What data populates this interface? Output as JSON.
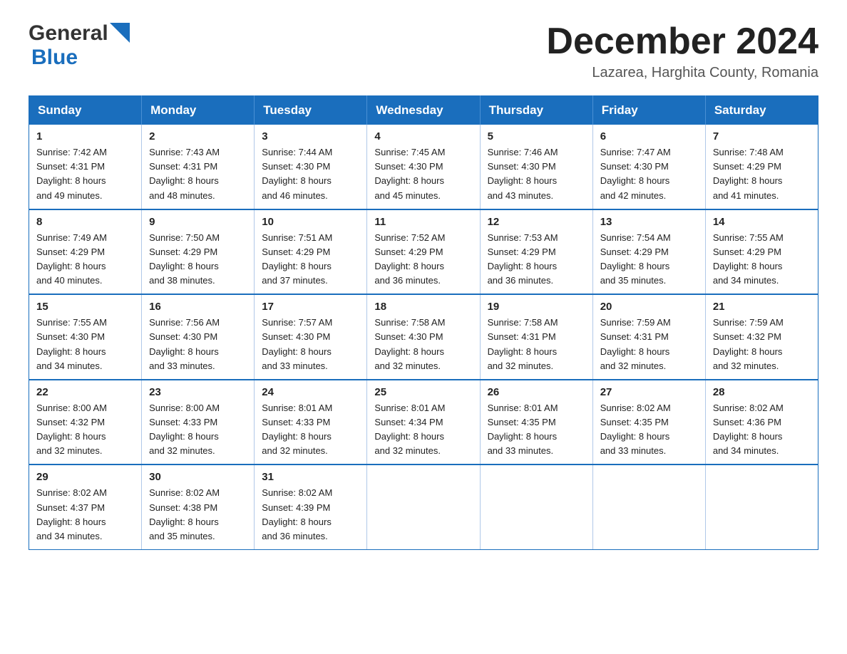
{
  "header": {
    "logo_general": "General",
    "logo_blue": "Blue",
    "month_title": "December 2024",
    "location": "Lazarea, Harghita County, Romania"
  },
  "calendar": {
    "days_of_week": [
      "Sunday",
      "Monday",
      "Tuesday",
      "Wednesday",
      "Thursday",
      "Friday",
      "Saturday"
    ],
    "weeks": [
      [
        {
          "day": "1",
          "sunrise": "7:42 AM",
          "sunset": "4:31 PM",
          "daylight": "8 hours and 49 minutes."
        },
        {
          "day": "2",
          "sunrise": "7:43 AM",
          "sunset": "4:31 PM",
          "daylight": "8 hours and 48 minutes."
        },
        {
          "day": "3",
          "sunrise": "7:44 AM",
          "sunset": "4:30 PM",
          "daylight": "8 hours and 46 minutes."
        },
        {
          "day": "4",
          "sunrise": "7:45 AM",
          "sunset": "4:30 PM",
          "daylight": "8 hours and 45 minutes."
        },
        {
          "day": "5",
          "sunrise": "7:46 AM",
          "sunset": "4:30 PM",
          "daylight": "8 hours and 43 minutes."
        },
        {
          "day": "6",
          "sunrise": "7:47 AM",
          "sunset": "4:30 PM",
          "daylight": "8 hours and 42 minutes."
        },
        {
          "day": "7",
          "sunrise": "7:48 AM",
          "sunset": "4:29 PM",
          "daylight": "8 hours and 41 minutes."
        }
      ],
      [
        {
          "day": "8",
          "sunrise": "7:49 AM",
          "sunset": "4:29 PM",
          "daylight": "8 hours and 40 minutes."
        },
        {
          "day": "9",
          "sunrise": "7:50 AM",
          "sunset": "4:29 PM",
          "daylight": "8 hours and 38 minutes."
        },
        {
          "day": "10",
          "sunrise": "7:51 AM",
          "sunset": "4:29 PM",
          "daylight": "8 hours and 37 minutes."
        },
        {
          "day": "11",
          "sunrise": "7:52 AM",
          "sunset": "4:29 PM",
          "daylight": "8 hours and 36 minutes."
        },
        {
          "day": "12",
          "sunrise": "7:53 AM",
          "sunset": "4:29 PM",
          "daylight": "8 hours and 36 minutes."
        },
        {
          "day": "13",
          "sunrise": "7:54 AM",
          "sunset": "4:29 PM",
          "daylight": "8 hours and 35 minutes."
        },
        {
          "day": "14",
          "sunrise": "7:55 AM",
          "sunset": "4:29 PM",
          "daylight": "8 hours and 34 minutes."
        }
      ],
      [
        {
          "day": "15",
          "sunrise": "7:55 AM",
          "sunset": "4:30 PM",
          "daylight": "8 hours and 34 minutes."
        },
        {
          "day": "16",
          "sunrise": "7:56 AM",
          "sunset": "4:30 PM",
          "daylight": "8 hours and 33 minutes."
        },
        {
          "day": "17",
          "sunrise": "7:57 AM",
          "sunset": "4:30 PM",
          "daylight": "8 hours and 33 minutes."
        },
        {
          "day": "18",
          "sunrise": "7:58 AM",
          "sunset": "4:30 PM",
          "daylight": "8 hours and 32 minutes."
        },
        {
          "day": "19",
          "sunrise": "7:58 AM",
          "sunset": "4:31 PM",
          "daylight": "8 hours and 32 minutes."
        },
        {
          "day": "20",
          "sunrise": "7:59 AM",
          "sunset": "4:31 PM",
          "daylight": "8 hours and 32 minutes."
        },
        {
          "day": "21",
          "sunrise": "7:59 AM",
          "sunset": "4:32 PM",
          "daylight": "8 hours and 32 minutes."
        }
      ],
      [
        {
          "day": "22",
          "sunrise": "8:00 AM",
          "sunset": "4:32 PM",
          "daylight": "8 hours and 32 minutes."
        },
        {
          "day": "23",
          "sunrise": "8:00 AM",
          "sunset": "4:33 PM",
          "daylight": "8 hours and 32 minutes."
        },
        {
          "day": "24",
          "sunrise": "8:01 AM",
          "sunset": "4:33 PM",
          "daylight": "8 hours and 32 minutes."
        },
        {
          "day": "25",
          "sunrise": "8:01 AM",
          "sunset": "4:34 PM",
          "daylight": "8 hours and 32 minutes."
        },
        {
          "day": "26",
          "sunrise": "8:01 AM",
          "sunset": "4:35 PM",
          "daylight": "8 hours and 33 minutes."
        },
        {
          "day": "27",
          "sunrise": "8:02 AM",
          "sunset": "4:35 PM",
          "daylight": "8 hours and 33 minutes."
        },
        {
          "day": "28",
          "sunrise": "8:02 AM",
          "sunset": "4:36 PM",
          "daylight": "8 hours and 34 minutes."
        }
      ],
      [
        {
          "day": "29",
          "sunrise": "8:02 AM",
          "sunset": "4:37 PM",
          "daylight": "8 hours and 34 minutes."
        },
        {
          "day": "30",
          "sunrise": "8:02 AM",
          "sunset": "4:38 PM",
          "daylight": "8 hours and 35 minutes."
        },
        {
          "day": "31",
          "sunrise": "8:02 AM",
          "sunset": "4:39 PM",
          "daylight": "8 hours and 36 minutes."
        },
        null,
        null,
        null,
        null
      ]
    ],
    "labels": {
      "sunrise": "Sunrise:",
      "sunset": "Sunset:",
      "daylight": "Daylight:"
    }
  }
}
